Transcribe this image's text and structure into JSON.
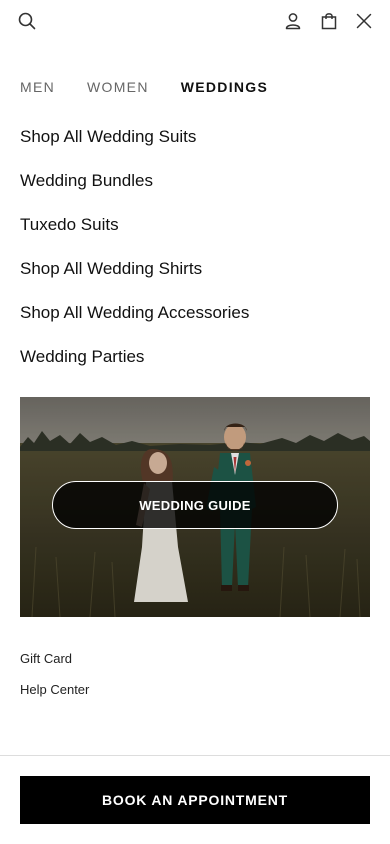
{
  "header": {
    "icons": [
      "search-icon",
      "account-icon",
      "bag-icon",
      "close-icon"
    ]
  },
  "tabs": [
    {
      "label": "MEN",
      "active": false
    },
    {
      "label": "WOMEN",
      "active": false
    },
    {
      "label": "WEDDINGS",
      "active": true
    }
  ],
  "menu": {
    "items": [
      "Shop All Wedding Suits",
      "Wedding Bundles",
      "Tuxedo Suits",
      "Shop All Wedding Shirts",
      "Shop All Wedding Accessories",
      "Wedding Parties"
    ]
  },
  "promo": {
    "button_label": "WEDDING GUIDE"
  },
  "links": {
    "gift_card": "Gift Card",
    "help_center": "Help Center"
  },
  "footer": {
    "book_label": "BOOK AN APPOINTMENT"
  },
  "colors": {
    "primary": "#000000",
    "text": "#111111",
    "inactive_tab": "#666666",
    "suit": "#1f5a4a"
  }
}
